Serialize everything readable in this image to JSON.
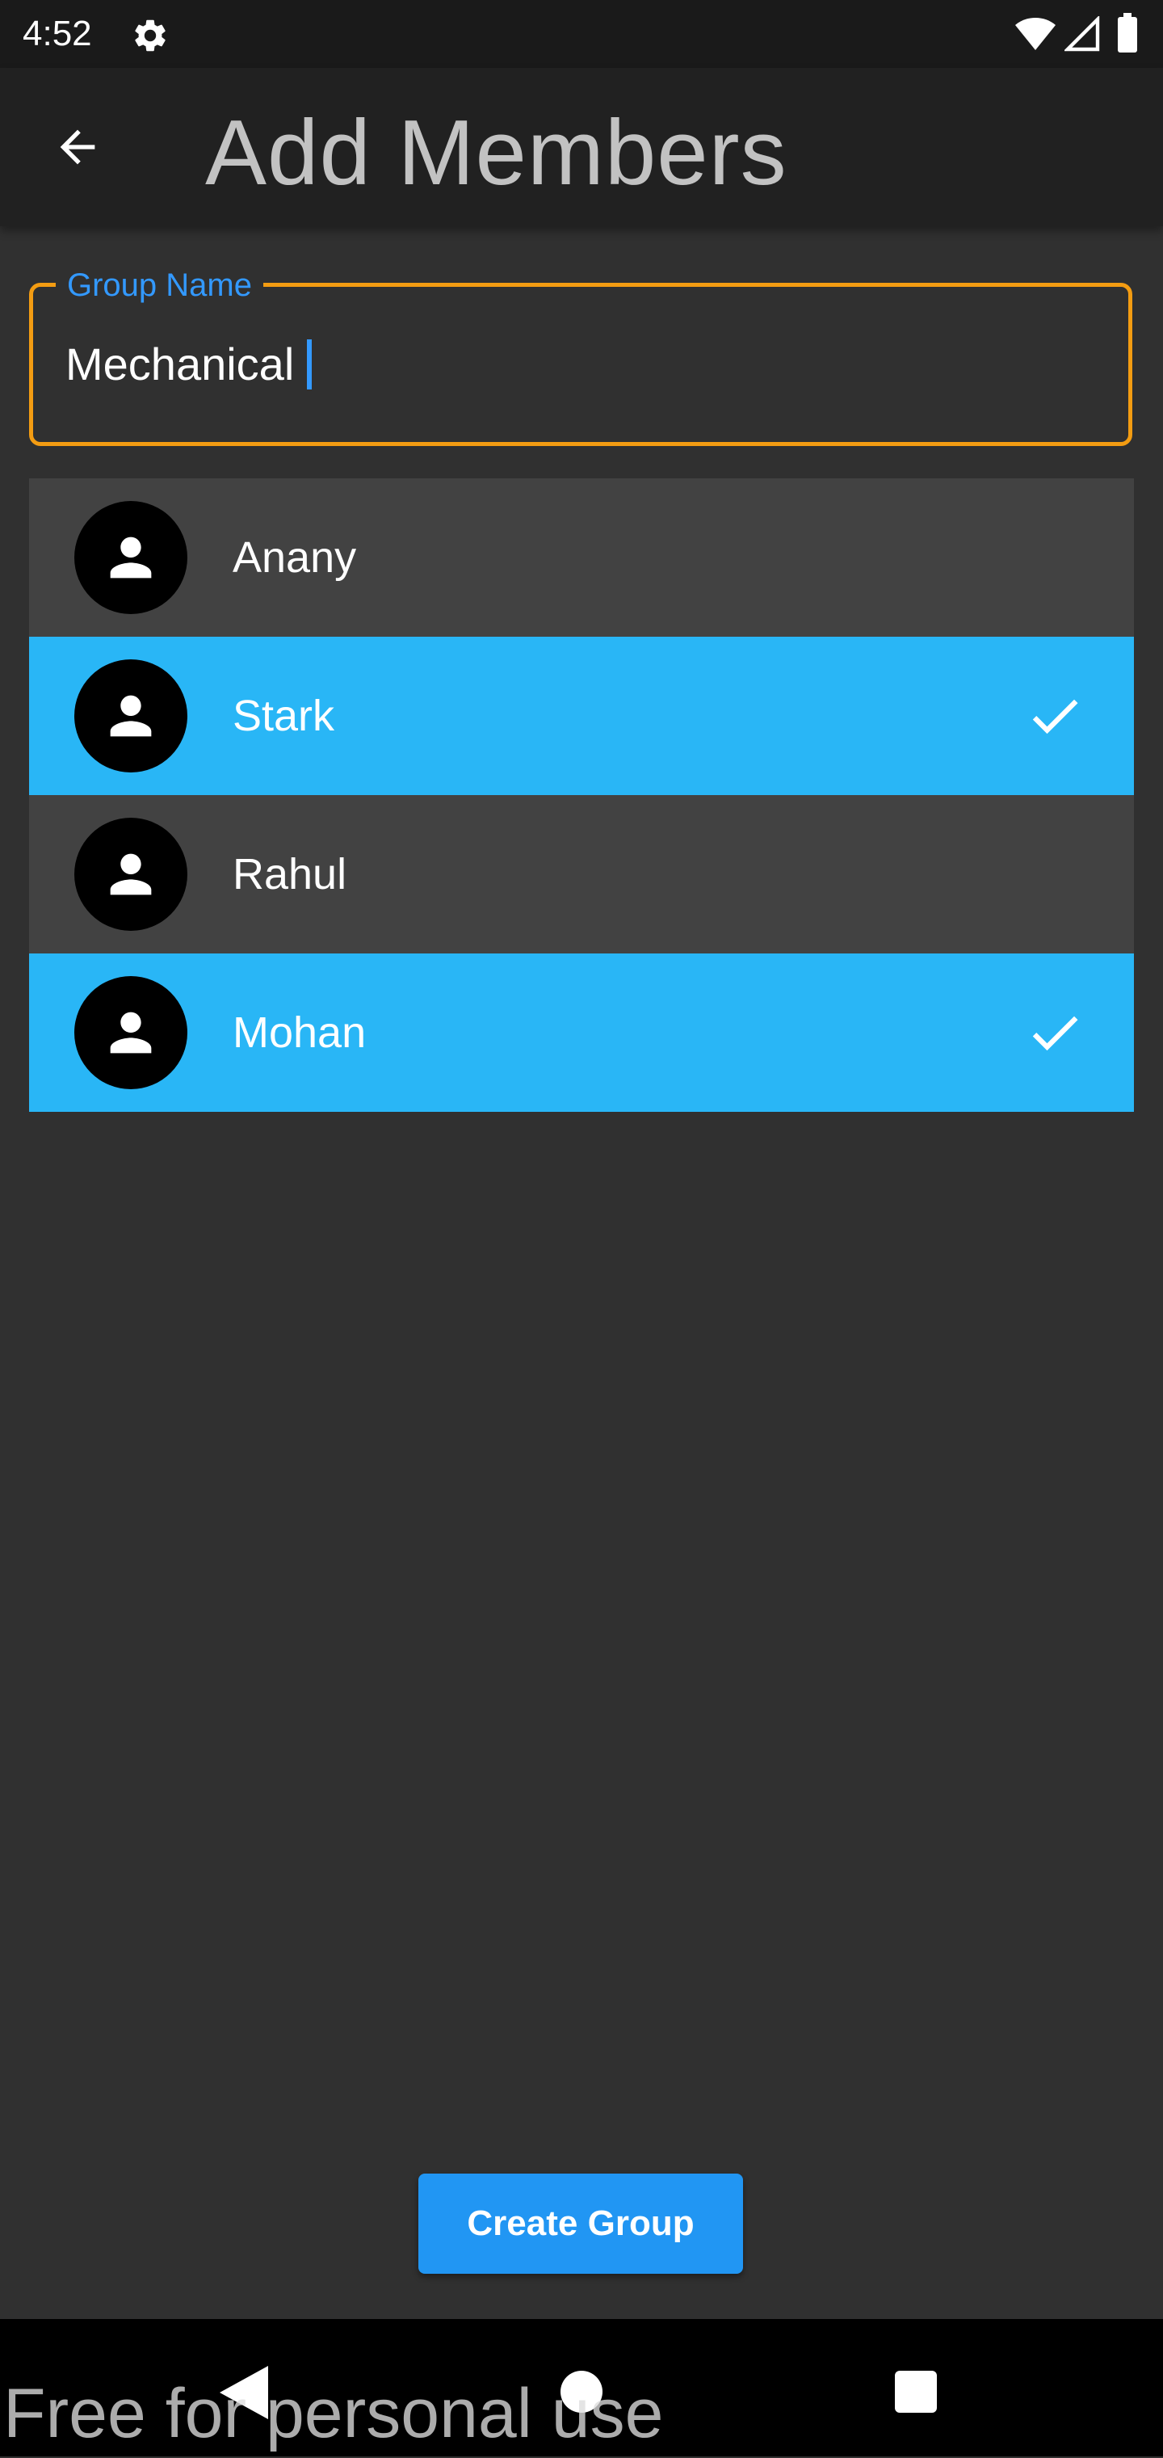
{
  "status_bar": {
    "time": "4:52",
    "icons": [
      "gear-icon",
      "wifi-icon",
      "signal-icon",
      "battery-icon"
    ]
  },
  "app_bar": {
    "title": "Add Members",
    "back_icon": "arrow-back-icon"
  },
  "group_field": {
    "label": "Group Name",
    "value": "Mechanical"
  },
  "members": [
    {
      "name": "Anany",
      "selected": false
    },
    {
      "name": "Stark",
      "selected": true
    },
    {
      "name": "Rahul",
      "selected": false
    },
    {
      "name": "Mohan",
      "selected": true
    }
  ],
  "create_button": {
    "label": "Create Group"
  },
  "nav_bar": {
    "icons": [
      "nav-back-icon",
      "nav-home-icon",
      "nav-recents-icon"
    ]
  },
  "watermark": "Free for personal use",
  "colors": {
    "background": "#303030",
    "app_bar": "#212121",
    "row": "#424242",
    "row_selected": "#29b6f6",
    "field_border": "#f39c12",
    "field_label": "#3399ff",
    "button": "#2196f3",
    "title_text": "#c2c2c2"
  }
}
